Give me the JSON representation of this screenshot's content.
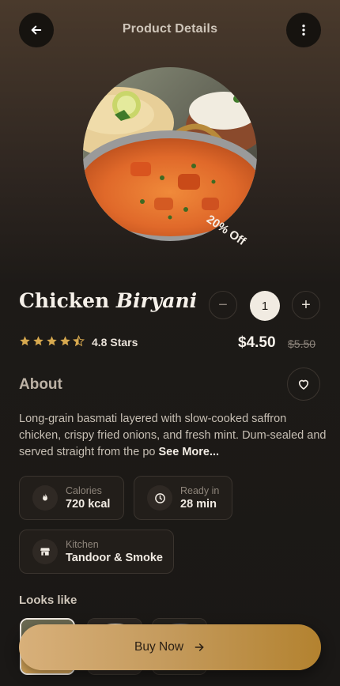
{
  "header": {
    "title": "Product Details",
    "back_icon": "arrow-left-icon",
    "menu_icon": "more-vertical-icon"
  },
  "product": {
    "name_plain": "Chicken",
    "name_italic": "Biryani",
    "discount_badge": "20% Off",
    "rating_value": 4.8,
    "rating_text": "4.8 Stars",
    "price": "$4.50",
    "old_price": "$5.50",
    "quantity": "1",
    "decrement_label": "−",
    "increment_label": "+"
  },
  "about": {
    "heading": "About",
    "description": "Long-grain basmati layered with slow-cooked saffron chicken, crispy fried onions, and fresh mint. Dum-sealed and served straight from the po",
    "see_more": "See More..."
  },
  "info_chips": [
    {
      "label": "Calories",
      "value": "720 kcal",
      "icon": "flame-icon"
    },
    {
      "label": "Ready in",
      "value": "28 min",
      "icon": "clock-icon"
    },
    {
      "label": "Kitchen",
      "value": "Tandoor & Smoke",
      "icon": "store-icon"
    }
  ],
  "gallery": {
    "heading": "Looks like",
    "selected_index": 0
  },
  "cta": {
    "label": "Buy Now",
    "icon": "arrow-right-icon"
  },
  "colors": {
    "accent_gold": "#c49a5c",
    "star": "#d7a94f",
    "background": "#1a1816"
  }
}
